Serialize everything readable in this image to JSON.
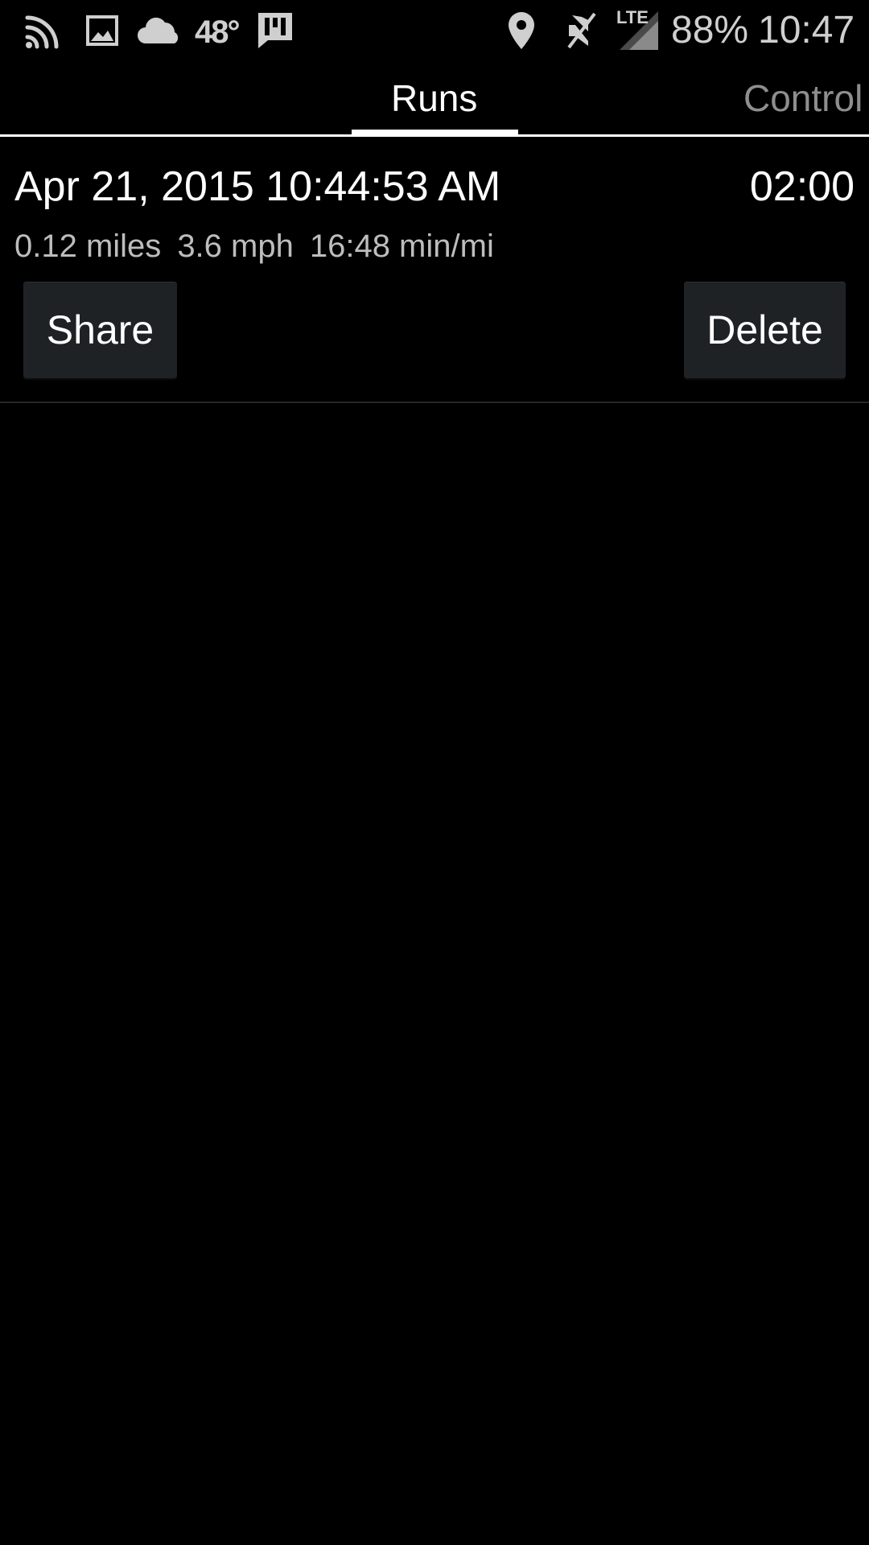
{
  "status_bar": {
    "icons_left": [
      "cast-icon",
      "image-icon",
      "cloud-icon",
      "news-icon"
    ],
    "temperature": "48°",
    "icons_right": [
      "location-icon",
      "mute-icon",
      "lte-signal-icon"
    ],
    "network_label": "LTE",
    "battery": "88%",
    "time": "10:47"
  },
  "tabs": [
    {
      "label": "Runs",
      "selected": true
    },
    {
      "label": "Control",
      "selected": false
    }
  ],
  "runs": [
    {
      "date": "Apr 21, 2015 10:44:53 AM",
      "duration": "02:00",
      "distance": "0.12 miles",
      "speed": "3.6 mph",
      "pace": "16:48 min/mi",
      "share_label": "Share",
      "delete_label": "Delete"
    }
  ],
  "colors": {
    "background": "#000000",
    "text_primary": "#ffffff",
    "text_secondary": "#bdbdbd",
    "tab_inactive": "#8e8e8e",
    "button_bg": "#1f2225"
  }
}
